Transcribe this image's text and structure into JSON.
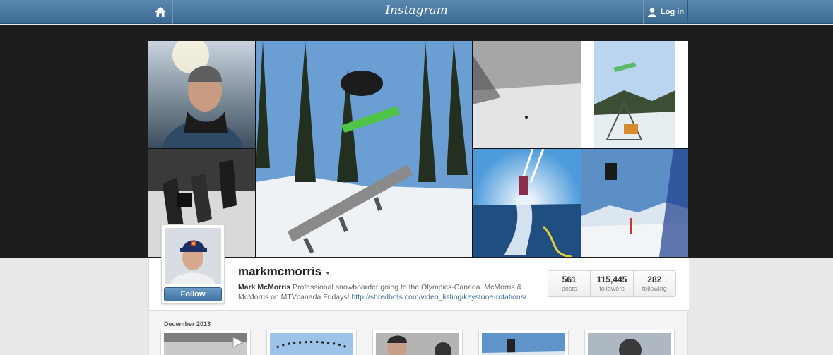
{
  "topbar": {
    "brand": "Instagram",
    "login_label": "Log in",
    "color": "#3f6f98"
  },
  "banner": {
    "tiles": [
      {
        "name": "photo-portrait-beanie",
        "colors": [
          "#7a8c9c",
          "#2c3b4a"
        ]
      },
      {
        "name": "photo-snowboard-rail-jump",
        "colors": [
          "#6fa2d6",
          "#e9eef4"
        ]
      },
      {
        "name": "photo-foggy-slope",
        "colors": [
          "#9a9a9a",
          "#d8d8d8"
        ]
      },
      {
        "name": "photo-tent-jump",
        "colors": [
          "#b8d3ee",
          "#d7e4ea"
        ]
      },
      {
        "name": "photo-crew-black-white",
        "colors": [
          "#555555",
          "#dddddd"
        ]
      },
      {
        "name": "photo-flyboard-water",
        "colors": [
          "#8ec8f2",
          "#1f5c8a"
        ]
      },
      {
        "name": "photo-mountain-air",
        "colors": [
          "#5f8fc4",
          "#e2ecf4"
        ]
      }
    ]
  },
  "profile": {
    "username": "markmcmorris",
    "follow_label": "Follow",
    "bio_name": "Mark McMorris",
    "bio_text": " Professional snowboarder going to the Olympics-Canada. McMorris & McMorris on MTVcanada Fridays! ",
    "bio_link": "http://shredbots.com/video_listing/keystone-rotations/",
    "stats": [
      {
        "value": "561",
        "label": "posts"
      },
      {
        "value": "115,445",
        "label": "followers"
      },
      {
        "value": "282",
        "label": "following"
      }
    ]
  },
  "feed": {
    "month_label": "December 2013",
    "thumbs": [
      {
        "name": "feed-thumb-1"
      },
      {
        "name": "feed-thumb-2"
      },
      {
        "name": "feed-thumb-3"
      },
      {
        "name": "feed-thumb-4"
      },
      {
        "name": "feed-thumb-5"
      }
    ]
  }
}
